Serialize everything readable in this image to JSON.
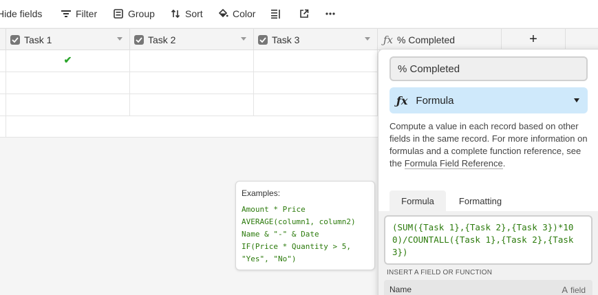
{
  "toolbar": {
    "hide_fields": "Hide fields",
    "filter": "Filter",
    "group": "Group",
    "sort": "Sort",
    "color": "Color"
  },
  "grid": {
    "columns": [
      {
        "label": "Task 1"
      },
      {
        "label": "Task 2"
      },
      {
        "label": "Task 3"
      },
      {
        "label": "% Completed"
      }
    ],
    "add_column_label": "+",
    "rows": [
      {
        "task1_checked": true,
        "task2_checked": false,
        "task3_checked": false
      },
      {
        "task1_checked": false,
        "task2_checked": false,
        "task3_checked": false
      },
      {
        "task1_checked": false,
        "task2_checked": false,
        "task3_checked": false
      }
    ],
    "check_glyph": "✔"
  },
  "examples": {
    "title": "Examples:",
    "lines": [
      "Amount * Price",
      "AVERAGE(column1, column2)",
      "Name & \"-\" & Date",
      "IF(Price * Quantity > 5,",
      "\"Yes\", \"No\")"
    ]
  },
  "panel": {
    "field_name_value": "% Completed",
    "field_type_label": "Formula",
    "description_text": "Compute a value in each record based on other fields in the same record. For more information on formulas and a complete function reference, see the ",
    "description_link": "Formula Field Reference",
    "description_end": ".",
    "tab_formula": "Formula",
    "tab_formatting": "Formatting",
    "formula_value": "(SUM({Task 1},{Task 2},{Task 3})*100)/COUNTALL({Task 1},{Task 2},{Task 3})",
    "insert_label": "INSERT A FIELD OR FUNCTION",
    "list_name_label": "Name",
    "list_field_icon": "A",
    "list_field_label": "field"
  },
  "colors": {
    "formula_text": "#2b7a0b",
    "type_select_bg": "#cfe9fb",
    "check_green": "#2ba52b"
  }
}
